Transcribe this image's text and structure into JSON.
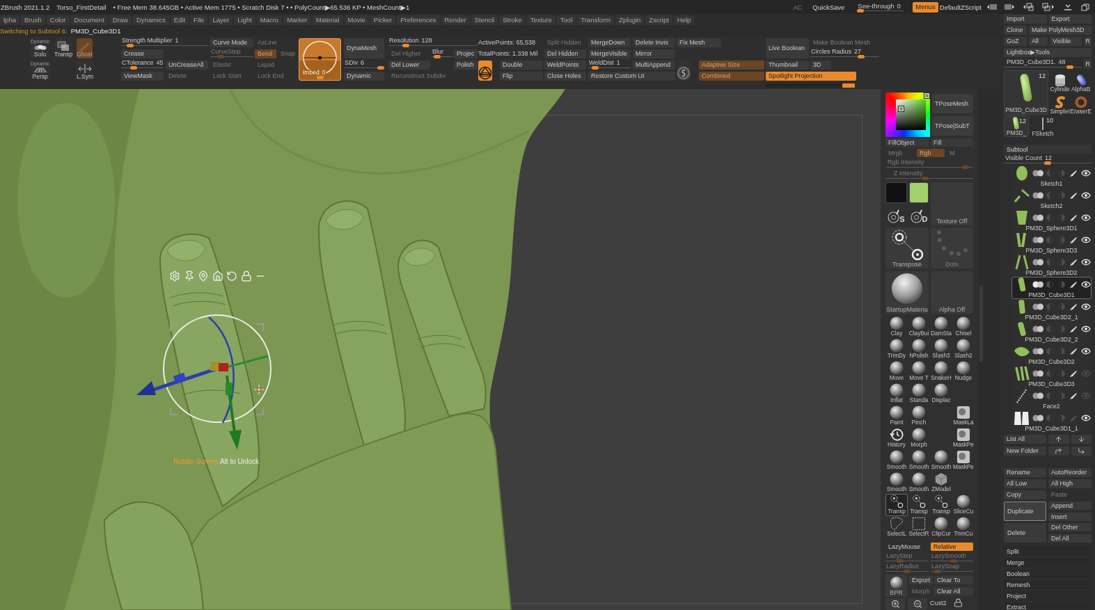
{
  "title_bar": {
    "app": "ZBrush 2021.1.2",
    "document": "Torso_FirstDetail",
    "info": "• Free Mem 38.645GB • Active Mem 1775 • Scratch Disk 7 • • PolyCount▶65.536 KP • MeshCount▶1",
    "items": [
      {
        "kind": "text",
        "label": "AC",
        "disabled": true
      },
      {
        "kind": "text",
        "label": "QuickSave",
        "disabled": false
      },
      {
        "kind": "slider",
        "label": "See-through",
        "value": "0",
        "level": 0,
        "disabled": false
      },
      {
        "kind": "button",
        "label": "Menus",
        "on": true,
        "disabled": false
      },
      {
        "kind": "text",
        "label": "DefaultZScript",
        "disabled": false
      }
    ]
  },
  "menu_bar": [
    "lpha",
    "Brush",
    "Color",
    "Document",
    "Draw",
    "Dynamics",
    "Edit",
    "File",
    "Layer",
    "Light",
    "Macro",
    "Marker",
    "Material",
    "Movie",
    "Picker",
    "Preferences",
    "Render",
    "Stencil",
    "Stroke",
    "Texture",
    "Tool",
    "Transform",
    "Zplugin",
    "Zscript",
    "Help"
  ],
  "notification": {
    "message": "Switching to Subtool 6:",
    "subtool": "PM3D_Cube3D1"
  },
  "shelf": {
    "groups": [
      {
        "items": [
          {
            "kind": "circles",
            "label": "Solo",
            "tag": "Dynamic",
            "on": false,
            "disabled": false
          },
          {
            "kind": "layers",
            "label": "Transp",
            "on": false,
            "disabled": false
          },
          {
            "kind": "ghost",
            "label": "Ghost",
            "on": true,
            "disabled": true
          },
          {
            "kind": "grid",
            "label": "Persp",
            "tag": "Dynamic",
            "on": false,
            "disabled": false
          },
          {
            "kind": "axis",
            "label": "L.Sym",
            "on": false,
            "disabled": false
          }
        ]
      },
      {
        "items": [
          {
            "kind": "slider",
            "label": "Strength Multiplier",
            "value": "1",
            "level": 0.07,
            "disabled": false
          },
          {
            "kind": "button",
            "label": "Crease",
            "on": false,
            "disabled": false
          },
          {
            "kind": "slider",
            "label": "CTolerance",
            "value": "45",
            "level": 0.25,
            "disabled": false
          },
          {
            "kind": "button",
            "label": "UnCreaseAll",
            "on": false,
            "disabled": false
          },
          {
            "kind": "button",
            "label": "ViewMask",
            "on": false,
            "disabled": false
          },
          {
            "kind": "button",
            "label": "Delete",
            "on": false,
            "disabled": true
          }
        ]
      },
      {
        "items": [
          {
            "kind": "button",
            "label": "Curve Mode",
            "on": false,
            "disabled": false
          },
          {
            "kind": "button",
            "label": "AsLine",
            "on": false,
            "disabled": true
          },
          {
            "kind": "slider",
            "label": "CurveStep",
            "level": 0.2,
            "disabled": true
          },
          {
            "kind": "button",
            "label": "Bend",
            "on": true,
            "disabled": true
          },
          {
            "kind": "button",
            "label": "Snap",
            "on": false,
            "disabled": true
          },
          {
            "kind": "button",
            "label": "Elastic",
            "on": false,
            "disabled": true
          },
          {
            "kind": "button",
            "label": "Liquid",
            "on": false,
            "disabled": true
          },
          {
            "kind": "button",
            "label": "Lock Start",
            "on": false,
            "disabled": true
          },
          {
            "kind": "button",
            "label": "Lock End",
            "on": false,
            "disabled": true
          }
        ]
      },
      {
        "items": [
          {
            "kind": "dial",
            "label": "Imbed",
            "value": "0",
            "level": 0.5
          }
        ]
      },
      {
        "items": [
          {
            "kind": "button",
            "label": "DynaMesh",
            "on": false,
            "disabled": false
          },
          {
            "kind": "slider",
            "label": "SDiv",
            "value": "6",
            "level": 1,
            "disabled": false
          },
          {
            "kind": "button",
            "label": "Dynamic",
            "on": false,
            "disabled": false
          }
        ]
      },
      {
        "items": [
          {
            "kind": "slider",
            "label": "Resolution",
            "value": "128",
            "level": 0.17,
            "disabled": false
          },
          {
            "kind": "button",
            "label": "Del Higher",
            "on": false,
            "disabled": true
          },
          {
            "kind": "slider",
            "label": "Blur",
            "level": 0.15,
            "disabled": false
          },
          {
            "kind": "button",
            "label": "Projec",
            "on": false,
            "disabled": false
          },
          {
            "kind": "button",
            "label": "Del Lower",
            "on": false,
            "disabled": false
          },
          {
            "kind": "button",
            "label": "Polish",
            "on": false,
            "disabled": false
          },
          {
            "kind": "button",
            "label": "Reconstruct Subdiv",
            "on": false,
            "disabled": true
          }
        ]
      },
      {
        "items": [
          {
            "kind": "text",
            "label": "ActivePoints: 65,538"
          },
          {
            "kind": "text",
            "label": "TotalPoints: 1.338 Mil"
          },
          {
            "kind": "orb",
            "on": true,
            "disabled": false
          },
          {
            "kind": "button",
            "label": "Double",
            "on": false,
            "disabled": false
          },
          {
            "kind": "button",
            "label": "Flip",
            "on": false,
            "disabled": false
          }
        ]
      },
      {
        "items": [
          {
            "kind": "button",
            "label": "Split Hidden",
            "on": false,
            "disabled": true
          },
          {
            "kind": "button",
            "label": "Del Hidden",
            "on": false,
            "disabled": false
          },
          {
            "kind": "button",
            "label": "WeldPoints",
            "on": false,
            "disabled": false
          },
          {
            "kind": "button",
            "label": "Close Holes",
            "on": false,
            "disabled": false
          }
        ]
      },
      {
        "items": [
          {
            "kind": "button",
            "label": "MergeDown",
            "on": false,
            "disabled": false
          },
          {
            "kind": "button",
            "label": "Delete Invis",
            "on": false,
            "disabled": false
          },
          {
            "kind": "button",
            "label": "MergeVisible",
            "on": false,
            "disabled": false
          },
          {
            "kind": "button",
            "label": "Mirror",
            "on": false,
            "disabled": false
          },
          {
            "kind": "slider",
            "label": "WeldDist",
            "value": "1",
            "level": 0.1,
            "disabled": false
          },
          {
            "kind": "button",
            "label": "MultiAppend",
            "on": false,
            "disabled": false
          },
          {
            "kind": "button",
            "label": "Restore Custom UI",
            "on": false,
            "disabled": false
          }
        ]
      },
      {
        "items": [
          {
            "kind": "button",
            "label": "Fix Mesh",
            "on": false,
            "disabled": false
          },
          {
            "kind": "disc",
            "on": false
          },
          {
            "kind": "button",
            "label": "Adaptive Size",
            "on": true,
            "disabled": true
          },
          {
            "kind": "button",
            "label": "Combined",
            "on": true,
            "disabled": true
          }
        ]
      },
      {
        "items": [
          {
            "kind": "button",
            "label": "Make Boolean Mesh",
            "on": false,
            "disabled": true
          },
          {
            "kind": "button",
            "label": "Live Boolean",
            "on": false,
            "disabled": false
          },
          {
            "kind": "slider",
            "label": "Circles Radius",
            "value": "27",
            "level": 0.76,
            "disabled": false
          },
          {
            "kind": "button",
            "label": "Thumbnail",
            "on": false,
            "disabled": false
          },
          {
            "kind": "button",
            "label": "3D",
            "on": false,
            "disabled": false
          },
          {
            "kind": "button",
            "label": "Spotlight Projection",
            "on": true,
            "disabled": false
          }
        ]
      }
    ]
  },
  "viewport": {
    "hint": {
      "action": "Rotate Screen",
      "key": "Alt to Unlock"
    }
  },
  "palette": {
    "tpose": [
      {
        "label": "TPoseMesh"
      },
      {
        "label": "TPose|SubT"
      }
    ],
    "fill": [
      {
        "label": "FillObject"
      },
      {
        "label": "Fill"
      }
    ],
    "color_mode": [
      {
        "label": "Mrgb",
        "on": false,
        "disabled": true
      },
      {
        "label": "Rgb",
        "on": true,
        "disabled": true
      },
      {
        "label": "M",
        "on": false,
        "disabled": true
      }
    ],
    "intensity": [
      {
        "label": "Rgb Intensity",
        "level": 0.95,
        "disabled": true
      },
      {
        "label": "Z Intensity",
        "level": 0.45,
        "disabled": true
      }
    ],
    "swatches": [
      {
        "color": "#111111"
      },
      {
        "color": "#a3cf6c"
      }
    ],
    "texture": "Texture Off",
    "stroke_modes": [
      "S",
      "D"
    ],
    "tiles": [
      {
        "kind": "gizmo",
        "label": "Transpose",
        "disabled": false
      },
      {
        "kind": "dots",
        "label": "Dots",
        "disabled": true
      },
      {
        "kind": "material",
        "label": "StartupMateria",
        "disabled": false
      },
      {
        "kind": "blank",
        "label": "Alpha Off",
        "disabled": false
      }
    ],
    "brush_rows": [
      [
        {
          "kind": "sphere",
          "label": "Clay",
          "selected": false
        },
        {
          "kind": "sphere",
          "label": "ClayBui",
          "selected": false
        },
        {
          "kind": "sphere",
          "label": "DamSta",
          "selected": false
        },
        {
          "kind": "sphere",
          "label": "Chisel",
          "selected": false
        }
      ],
      [
        {
          "kind": "sphere",
          "label": "TrimDy",
          "selected": false
        },
        {
          "kind": "sphere",
          "label": "hPolish",
          "selected": false
        },
        {
          "kind": "sphere",
          "label": "Slash3",
          "selected": false
        },
        {
          "kind": "sphere",
          "label": "Slash2",
          "selected": false
        }
      ],
      [
        {
          "kind": "sphere",
          "label": "Move",
          "selected": false
        },
        {
          "kind": "sphere",
          "label": "Move T",
          "selected": false
        },
        {
          "kind": "sphere",
          "label": "SnakeH",
          "selected": false
        },
        {
          "kind": "sphere",
          "label": "Nudge",
          "selected": false
        }
      ],
      [
        {
          "kind": "sphere",
          "label": "Inflat",
          "selected": false
        },
        {
          "kind": "sphere",
          "label": "Standa",
          "selected": false
        },
        {
          "kind": "sphere",
          "label": "Displac",
          "selected": false
        }
      ],
      [
        {
          "kind": "sphere",
          "label": "Paint",
          "selected": false
        },
        {
          "kind": "sphere",
          "label": "Pinch",
          "selected": false
        },
        {
          "kind": "mask",
          "label": "MaskLa",
          "selected": false
        }
      ],
      [
        {
          "kind": "clock",
          "label": "History",
          "selected": false
        },
        {
          "kind": "sphere",
          "label": "Morph",
          "selected": false
        },
        {
          "kind": "mask",
          "label": "MaskPe",
          "selected": false
        }
      ],
      [
        {
          "kind": "sphere",
          "label": "Smooth",
          "selected": false
        },
        {
          "kind": "sphere",
          "label": "Smooth",
          "selected": false
        },
        {
          "kind": "sphere",
          "label": "Smooth",
          "selected": false
        },
        {
          "kind": "mask",
          "label": "MaskPe",
          "selected": false
        }
      ],
      [
        {
          "kind": "sphere",
          "label": "Smooth",
          "selected": false
        },
        {
          "kind": "sphere",
          "label": "Smooth",
          "selected": false
        },
        {
          "kind": "cube",
          "label": "ZModel",
          "selected": false
        }
      ],
      [
        {
          "kind": "gizmo",
          "label": "Transp",
          "selected": true
        },
        {
          "kind": "gizmo",
          "label": "Transp",
          "selected": false
        },
        {
          "kind": "gizmo",
          "label": "Transp",
          "selected": false
        },
        {
          "kind": "sphere",
          "label": "SliceCu",
          "selected": false
        }
      ],
      [
        {
          "kind": "lasso",
          "label": "SelectL",
          "selected": false
        },
        {
          "kind": "marquee",
          "label": "SelectR",
          "selected": false
        },
        {
          "kind": "sphere",
          "label": "ClipCur",
          "selected": false
        },
        {
          "kind": "sphere",
          "label": "TrimCu",
          "selected": false
        }
      ]
    ],
    "lazy_mouse": {
      "label": "LazyMouse",
      "mode": "Relative",
      "on": true
    },
    "lazy_sliders": [
      {
        "label": "LazyStep",
        "level": 0.3,
        "disabled": true
      },
      {
        "label": "LazySmooth",
        "level": 0.55,
        "disabled": true
      },
      {
        "label": "LazyRadius",
        "level": 0.5,
        "disabled": true
      },
      {
        "label": "LazySnap",
        "level": 0.1,
        "disabled": true
      }
    ],
    "bpr": "BPR",
    "morph": [
      {
        "label": "Export",
        "disabled": false
      },
      {
        "label": "Clear To",
        "disabled": false
      },
      {
        "label": "Morph",
        "disabled": true
      },
      {
        "label": "Clear All",
        "disabled": false
      }
    ],
    "custom": "Cust2"
  },
  "tool_panel": {
    "button_rows": [
      [
        {
          "label": "Import"
        },
        {
          "label": "Export"
        }
      ],
      [
        {
          "label": "Clone"
        },
        {
          "label": "Make PolyMesh3D"
        }
      ],
      [
        {
          "label": "GoZ"
        },
        {
          "label": "All"
        },
        {
          "label": "Visible"
        },
        {
          "label": "R"
        }
      ],
      [
        {
          "label": "Lightbox▶Tools"
        }
      ]
    ],
    "tool_slider": {
      "label": "PM3D_Cube3D1.",
      "value": "48",
      "level": 0.88
    },
    "tool_reset": "R",
    "tools": [
      {
        "label": "PM3D_Cube3D",
        "count": "12"
      },
      {
        "label": "Cylinde"
      },
      {
        "label": "AlphaB"
      },
      {
        "label": "SimpleI"
      },
      {
        "label": "EraserE"
      },
      {
        "label": "PM3D_",
        "count": "12"
      },
      {
        "label": "FSketch",
        "count": "10"
      }
    ],
    "subtool": {
      "title": "Subtool",
      "visible_count": {
        "label": "Visible Count",
        "value": "12",
        "level": 0.5
      },
      "items": [
        {
          "name": "Sketch1",
          "selected": false,
          "visible": true,
          "paint": true
        },
        {
          "name": "Sketch2",
          "selected": false,
          "visible": true,
          "paint": true
        },
        {
          "name": "PM3D_Sphere3D1",
          "selected": false,
          "visible": true,
          "paint": true
        },
        {
          "name": "PM3D_Sphere3D3",
          "selected": false,
          "visible": true,
          "paint": true
        },
        {
          "name": "PM3D_Sphere3D2",
          "selected": false,
          "visible": true,
          "paint": true
        },
        {
          "name": "PM3D_Cube3D1",
          "selected": true,
          "visible": true,
          "paint": true
        },
        {
          "name": "PM3D_Cube3D2_1",
          "selected": false,
          "visible": true,
          "paint": true
        },
        {
          "name": "PM3D_Cube3D2_2",
          "selected": false,
          "visible": true,
          "paint": true
        },
        {
          "name": "PM3D_Cube3D2",
          "selected": false,
          "visible": true,
          "paint": true
        },
        {
          "name": "PM3D_Cube3D3",
          "selected": false,
          "visible": false,
          "paint": true
        },
        {
          "name": "Face2",
          "selected": false,
          "visible": false,
          "paint": true
        },
        {
          "name": "PM3D_Cube3D1_1",
          "selected": false,
          "visible": true,
          "paint": false
        }
      ],
      "list_all": "List All",
      "new_folder": "New Folder",
      "action_rows": [
        [
          {
            "label": "Rename",
            "disabled": false
          },
          {
            "label": "AutoReorder",
            "disabled": false
          }
        ],
        [
          {
            "label": "All Low",
            "disabled": false
          },
          {
            "label": "All High",
            "disabled": false
          }
        ],
        [
          {
            "label": "Copy",
            "disabled": false
          },
          {
            "label": "Paste",
            "disabled": true
          }
        ]
      ],
      "tall_actions": [
        {
          "label": "Duplicate",
          "highlighted": true,
          "side": [
            "Append",
            "Insert"
          ]
        },
        {
          "label": "Delete",
          "highlighted": false,
          "side": [
            "Del Other",
            "Del All"
          ]
        }
      ],
      "sections": [
        "Split",
        "Merge",
        "Boolean",
        "Remesh",
        "Project",
        "Extract"
      ]
    }
  }
}
